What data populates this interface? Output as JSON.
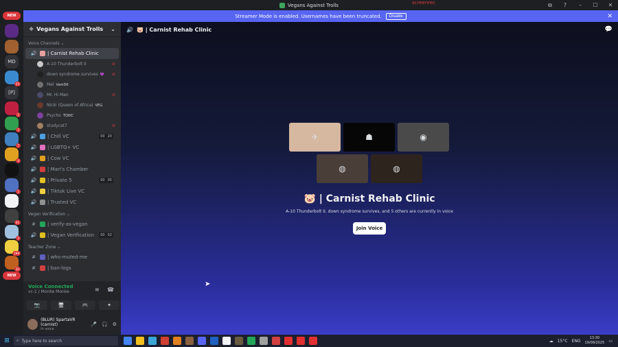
{
  "window": {
    "title": "Vegans Against Trolls",
    "recorder": "screenrec",
    "controls": [
      "⧉",
      "?",
      "–",
      "☐",
      "✕"
    ]
  },
  "badges": {
    "new": "NEW"
  },
  "banner": {
    "text": "Streamer Mode is enabled. Usernames have been truncated.",
    "disable_label": "Disable"
  },
  "server_rail": {
    "items": [
      {
        "label": "",
        "count": "",
        "color": "#5b2a86"
      },
      {
        "label": "",
        "count": "",
        "color": "#a06030"
      },
      {
        "label": "MD",
        "count": "",
        "color": "#313338"
      },
      {
        "label": "",
        "count": "25",
        "color": "#3a8ad0"
      },
      {
        "label": "[P]",
        "count": "",
        "color": "#313338"
      },
      {
        "label": "",
        "count": "1",
        "color": "#c02040"
      },
      {
        "label": "",
        "count": "1",
        "color": "#30a050"
      },
      {
        "label": "",
        "count": "7",
        "color": "#4080c0"
      },
      {
        "label": "",
        "count": "4",
        "color": "#e0a020"
      },
      {
        "label": "",
        "count": "",
        "color": "#111111"
      },
      {
        "label": "",
        "count": "1",
        "color": "#5070c0"
      },
      {
        "label": "",
        "count": "",
        "color": "#f2f3f5"
      },
      {
        "label": "",
        "count": "41",
        "color": "#404040"
      },
      {
        "label": "",
        "count": "1",
        "color": "#a0c0e0"
      },
      {
        "label": "",
        "count": "199",
        "color": "#f0d040"
      },
      {
        "label": "",
        "count": "35",
        "color": "#c06020"
      }
    ]
  },
  "sidebar": {
    "guild_name": "Vegans Against Trolls",
    "categories": [
      {
        "label": "Voice Channels ⌄",
        "channels": [
          {
            "icon": "🔊",
            "emoji_color": "#e8a0a0",
            "label": "| Carnist Rehab Clinic",
            "active": true,
            "limit": []
          },
          {
            "icon": "🔊",
            "emoji_color": "#4aa0e0",
            "label": "| Chill VC",
            "active": false,
            "limit": [
              "00",
              "20"
            ]
          },
          {
            "icon": "🔊",
            "emoji_color": "#e070c0",
            "label": "| LGBTQ+ VC",
            "active": false,
            "limit": []
          },
          {
            "icon": "🔊",
            "emoji_color": "#e0a020",
            "label": "| Cow VC",
            "active": false,
            "limit": []
          },
          {
            "icon": "🔊",
            "emoji_color": "#d04040",
            "label": "| Mari's Chamber",
            "active": false,
            "limit": []
          },
          {
            "icon": "🔊",
            "emoji_color": "#e0c020",
            "label": "| Private 5",
            "active": false,
            "limit": [
              "00",
              "05"
            ]
          },
          {
            "icon": "🔊",
            "emoji_color": "#f0d040",
            "label": "| Tiktok Live VC",
            "active": false,
            "limit": []
          },
          {
            "icon": "🔊",
            "emoji_color": "#909090",
            "label": "| Trusted VC",
            "active": false,
            "limit": []
          }
        ]
      },
      {
        "label": "Vegan Verification ⌄",
        "channels": [
          {
            "icon": "#",
            "emoji_color": "#23a559",
            "label": "| verify-as-vegan",
            "active": false,
            "limit": []
          },
          {
            "icon": "🔊",
            "emoji_color": "#e0c020",
            "label": "| Vegan Verification",
            "active": false,
            "limit": [
              "00",
              "02"
            ]
          }
        ]
      },
      {
        "label": "Teacher Zone ⌄",
        "channels": [
          {
            "icon": "#",
            "emoji_color": "#6060c0",
            "label": "| who-muted-me",
            "active": false,
            "limit": []
          },
          {
            "icon": "#",
            "emoji_color": "#d04040",
            "label": "| ban-logs",
            "active": false,
            "limit": []
          }
        ]
      }
    ],
    "voice_users": [
      {
        "name": "A-10 Thunderbolt II",
        "tag": "",
        "avatar": "#c8c8c8",
        "muted": true
      },
      {
        "name": "down syndrome survives",
        "tag": "💜",
        "avatar": "#202020",
        "muted": true
      },
      {
        "name": "Mel",
        "tag": "VamDK",
        "avatar": "#707070",
        "muted": false
      },
      {
        "name": "Mr. Hi Man",
        "tag": "",
        "avatar": "#4a4a6a",
        "muted": true
      },
      {
        "name": "Nicki (Queen of Africa)",
        "tag": "VEG",
        "avatar": "#6a3a2a",
        "muted": false
      },
      {
        "name": "Psycho",
        "tag": "TOXIC",
        "avatar": "#8040a0",
        "muted": false
      },
      {
        "name": "studycat7",
        "tag": "",
        "avatar": "#a08060",
        "muted": true
      }
    ]
  },
  "voice_panel": {
    "status": "Voice Connected",
    "sub": "vc-1 / Monke Monke",
    "buttons": [
      "📷",
      "🖥",
      "🎮",
      "✦"
    ]
  },
  "user_panel": {
    "name": "(BLUR) SpartaVR (carnist)",
    "status": "In voice",
    "controls": [
      "🎤",
      "🎧",
      "⚙"
    ]
  },
  "main": {
    "header_title": "🐷 | Carnist Rehab Clinic",
    "tiles": [
      {
        "color": "#d6b7a0",
        "glyph": "✈"
      },
      {
        "color": "#060606",
        "glyph": "☗"
      },
      {
        "color": "#4a4a4a",
        "glyph": "◉"
      },
      {
        "color": "#4a3e38",
        "glyph": "◍"
      },
      {
        "color": "#2e241e",
        "glyph": "◍"
      }
    ],
    "channel_title": "🐷 | Carnist Rehab Clinic",
    "description": "A-10 Thunderbolt II, down syndrome survives, and 5 others are currently in voice",
    "join_label": "Join Voice"
  },
  "taskbar": {
    "search_placeholder": "Type here to search",
    "weather": "15°C",
    "lang": "ENG",
    "time": "13:30",
    "date": "19/08/2025",
    "app_colors": [
      "#4285f4",
      "#f0c020",
      "#3ba5d8",
      "#d04030",
      "#e08020",
      "#8a6040",
      "#5865f2",
      "#2060c0",
      "#f2f3f5",
      "#6a5a40",
      "#23a559",
      "#a0a0a0",
      "#d04040",
      "#e03030",
      "#e03030",
      "#e03030"
    ]
  }
}
